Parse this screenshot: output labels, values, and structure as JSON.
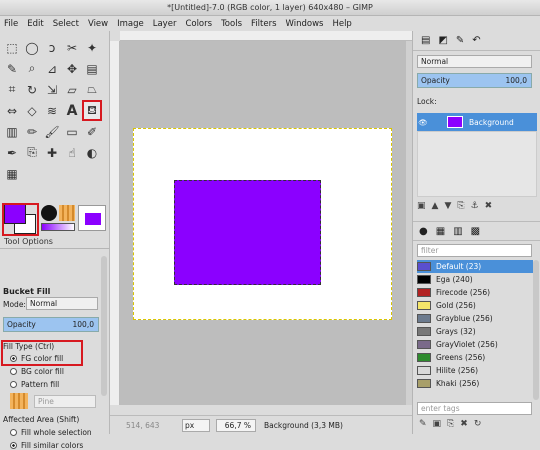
{
  "window": {
    "title": "*[Untitled]-7.0 (RGB color, 1 layer) 640x480 – GIMP"
  },
  "menu": [
    "File",
    "Edit",
    "Select",
    "View",
    "Image",
    "Layer",
    "Colors",
    "Tools",
    "Filters",
    "Windows",
    "Help"
  ],
  "tools": [
    "free-select-icon",
    "fuzzy-select-icon",
    "lasso-icon",
    "scissors-icon",
    "paths-icon",
    "color-picker-icon",
    "zoom-icon",
    "measure-icon",
    "move-icon",
    "align-icon",
    "crop-icon",
    "rotate-icon",
    "scale-icon",
    "shear-icon",
    "perspective-icon",
    "flip-icon",
    "cage-icon",
    "warp-icon",
    "text-icon",
    "bucket-fill-icon",
    "blend-icon",
    "pencil-icon",
    "paintbrush-icon",
    "eraser-icon",
    "airbrush-icon",
    "ink-icon",
    "clone-icon",
    "heal-icon",
    "smudge-icon",
    "dodge-icon",
    "color-tool-icon"
  ],
  "tool_options": {
    "tab_label": "Tool Options",
    "title": "Bucket Fill",
    "mode_label": "Mode:",
    "mode_value": "Normal",
    "opacity_label": "Opacity",
    "opacity_value": "100,0",
    "fill_type_label": "Fill Type  (Ctrl)",
    "fill_options": [
      "FG color fill",
      "BG color fill",
      "Pattern fill"
    ],
    "pattern_name": "Pine",
    "affected_label": "Affected Area  (Shift)",
    "affected_options": [
      "Fill whole selection",
      "Fill similar colors"
    ]
  },
  "status": {
    "coords": "514, 643",
    "unit": "px",
    "zoom": "66,7 %",
    "message": "Background (3,3 MB)"
  },
  "layers": {
    "mode_value": "Normal",
    "opacity_label": "Opacity",
    "opacity_value": "100,0",
    "lock_label": "Lock:",
    "layer_name": "Background"
  },
  "palettes": {
    "filter_placeholder": "filter",
    "tag_placeholder": "enter tags",
    "items": [
      {
        "name": "Default (23)",
        "color": "#5a4fcf",
        "selected": true
      },
      {
        "name": "Ega (240)",
        "color": "#000000",
        "selected": false
      },
      {
        "name": "Firecode (256)",
        "color": "#b22222",
        "selected": false
      },
      {
        "name": "Gold (256)",
        "color": "#f5e66a",
        "selected": false
      },
      {
        "name": "Grayblue (256)",
        "color": "#6c7b8f",
        "selected": false
      },
      {
        "name": "Grays (32)",
        "color": "#777777",
        "selected": false
      },
      {
        "name": "GrayViolet (256)",
        "color": "#7a6a8a",
        "selected": false
      },
      {
        "name": "Greens (256)",
        "color": "#2e8b2e",
        "selected": false
      },
      {
        "name": "Hilite (256)",
        "color": "#d9d9d9",
        "selected": false
      },
      {
        "name": "Khaki (256)",
        "color": "#a89f6a",
        "selected": false
      }
    ]
  },
  "colors": {
    "fg": "#8b00ff",
    "bg": "#ffffff",
    "highlight": "#d71920"
  }
}
